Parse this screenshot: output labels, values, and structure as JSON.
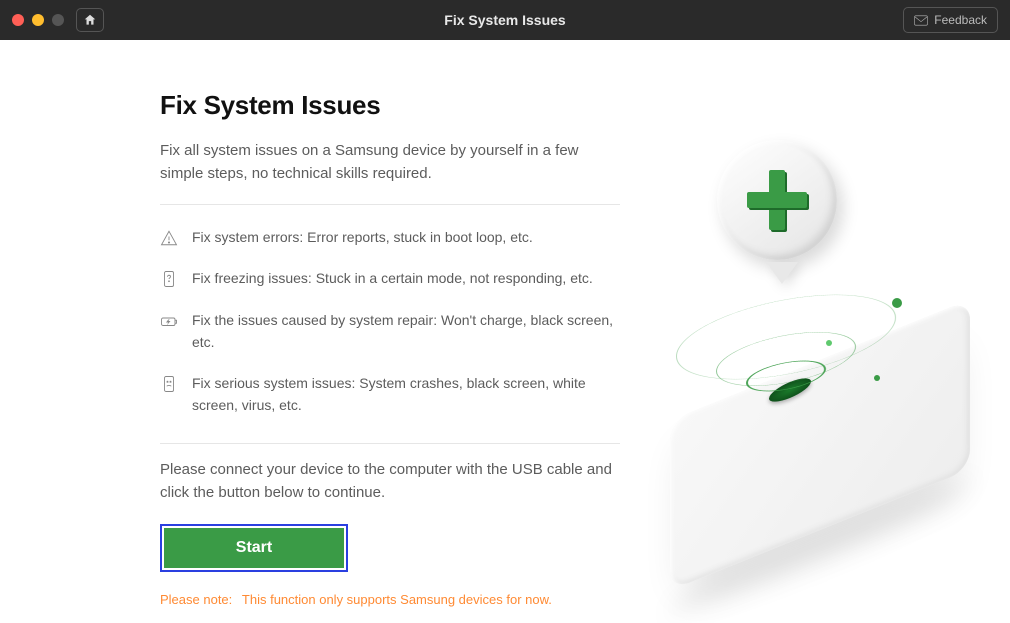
{
  "titlebar": {
    "title": "Fix System Issues",
    "feedback_label": "Feedback"
  },
  "page": {
    "heading": "Fix System Issues",
    "intro": "Fix all system issues on a Samsung device by yourself in a few simple steps, no technical skills required.",
    "features": [
      {
        "icon": "warning-triangle-icon",
        "text": "Fix system errors: Error reports, stuck in boot loop, etc."
      },
      {
        "icon": "phone-question-icon",
        "text": "Fix freezing issues: Stuck in a certain mode, not responding, etc."
      },
      {
        "icon": "battery-icon",
        "text": "Fix the issues caused by system repair: Won't charge, black screen, etc."
      },
      {
        "icon": "dead-phone-icon",
        "text": "Fix serious system issues: System crashes, black screen, white screen, virus, etc."
      }
    ],
    "connect_msg": "Please connect your device to the computer with the USB cable and click the button below to continue.",
    "start_label": "Start",
    "note_label": "Please note:",
    "note_text": "This function only supports Samsung devices for now."
  },
  "colors": {
    "accent_green": "#3a9b46",
    "highlight_blue": "#2a3fe0",
    "warning_orange": "#ff8a33"
  }
}
